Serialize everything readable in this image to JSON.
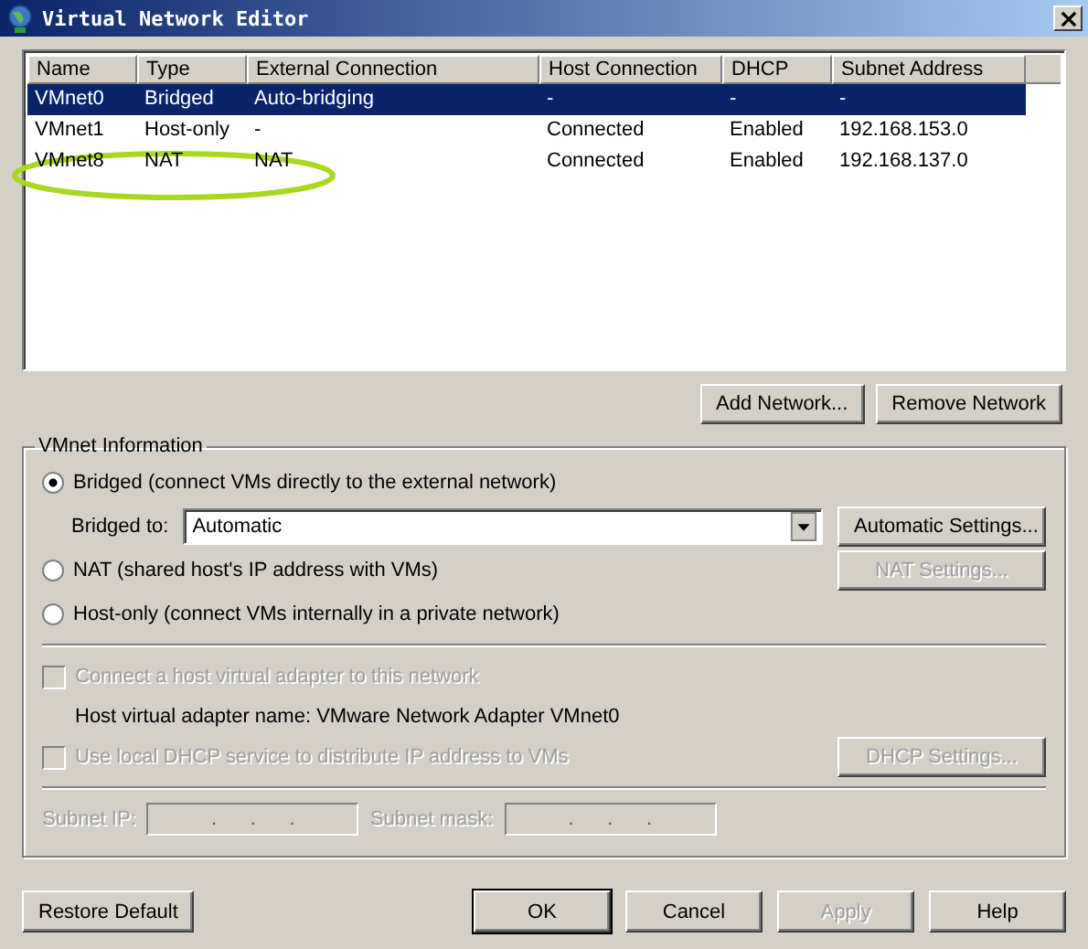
{
  "window": {
    "title": "Virtual Network Editor"
  },
  "table": {
    "columns": [
      "Name",
      "Type",
      "External Connection",
      "Host Connection",
      "DHCP",
      "Subnet Address"
    ],
    "rows": [
      {
        "cells": [
          "VMnet0",
          "Bridged",
          "Auto-bridging",
          "-",
          "-",
          "-"
        ],
        "selected": true
      },
      {
        "cells": [
          "VMnet1",
          "Host-only",
          "-",
          "Connected",
          "Enabled",
          "192.168.153.0"
        ],
        "selected": false
      },
      {
        "cells": [
          "VMnet8",
          "NAT",
          "NAT",
          "Connected",
          "Enabled",
          "192.168.137.0"
        ],
        "selected": false
      }
    ]
  },
  "list_buttons": [
    {
      "label": "Add Network...",
      "disabled": false
    },
    {
      "label": "Remove Network",
      "disabled": false
    }
  ],
  "vmnet_info": {
    "title": "VMnet Information",
    "modes": [
      {
        "label": "Bridged (connect VMs directly to the external network)",
        "selected": true
      },
      {
        "label": "NAT (shared host's IP address with VMs)",
        "selected": false
      },
      {
        "label": "Host-only (connect VMs internally in a private network)",
        "selected": false
      }
    ],
    "bridged_to": {
      "label": "Bridged to:",
      "value": "Automatic"
    },
    "automatic_settings": {
      "label": "Automatic Settings...",
      "disabled": false
    },
    "nat_settings": {
      "label": "NAT Settings...",
      "disabled": true
    },
    "connect_adapter": {
      "label": "Connect a host virtual adapter to this network",
      "checked": false,
      "disabled": true
    },
    "adapter_name": "Host virtual adapter name: VMware Network Adapter VMnet0",
    "dhcp": {
      "label": "Use local DHCP service to distribute IP address to VMs",
      "checked": false,
      "disabled": true
    },
    "dhcp_settings": {
      "label": "DHCP Settings...",
      "disabled": true
    },
    "subnet_ip": {
      "label": "Subnet IP:",
      "value": ".      .      .",
      "disabled": true
    },
    "subnet_mask": {
      "label": "Subnet mask:",
      "value": ".      .      .",
      "disabled": true
    }
  },
  "footer": {
    "restore": {
      "label": "Restore Default",
      "disabled": false
    },
    "buttons": [
      {
        "label": "OK",
        "disabled": false,
        "default": true
      },
      {
        "label": "Cancel",
        "disabled": false,
        "default": false
      },
      {
        "label": "Apply",
        "disabled": true,
        "default": false
      },
      {
        "label": "Help",
        "disabled": false,
        "default": false
      }
    ]
  }
}
